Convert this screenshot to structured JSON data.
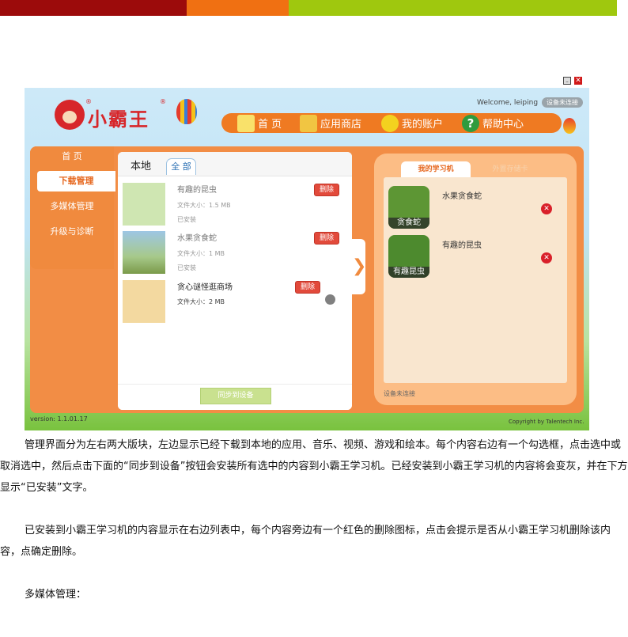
{
  "window": {
    "minimize_glyph": "–",
    "close_glyph": "✕"
  },
  "header": {
    "logo_text": "小霸王",
    "registered_mark": "®",
    "welcome": "Welcome, leiping",
    "connection_badge": "设备未连接"
  },
  "nav": [
    {
      "label": "首 页",
      "icon": "house-icon"
    },
    {
      "label": "应用商店",
      "icon": "gift-box-icon"
    },
    {
      "label": "我的账户",
      "icon": "smiley-face-icon"
    },
    {
      "label": "帮助中心",
      "icon": "question-mark-icon",
      "glyph": "?"
    }
  ],
  "sidebar": {
    "items": [
      {
        "label": "首 页"
      },
      {
        "label": "下载管理",
        "active": true
      },
      {
        "label": "多媒体管理"
      },
      {
        "label": "升级与诊断"
      }
    ]
  },
  "local_panel": {
    "title": "本地",
    "filter_tab": "全 部",
    "items": [
      {
        "name": "有趣的昆虫",
        "size": "文件大小：1.5 MB",
        "status": "已安装",
        "delete": "删除"
      },
      {
        "name": "水果贪食蛇",
        "size": "文件大小：1 MB",
        "status": "已安装",
        "delete": "删除"
      },
      {
        "name": "贪心谜怪逛商场",
        "size": "文件大小：2 MB",
        "status": "",
        "delete": "删除"
      }
    ],
    "sync_button": "同步到设备",
    "arrow_glyph": "❯"
  },
  "device_panel": {
    "tab_active": "我的学习机",
    "tab_inactive": "外置存储卡",
    "items": [
      {
        "name": "水果贪食蛇",
        "icon_caption": "贪食蛇"
      },
      {
        "name": "有趣的昆虫",
        "icon_caption": "有趣昆虫"
      }
    ],
    "delete_glyph": "✕",
    "status": "设备未连接"
  },
  "footer": {
    "version": "version: 1.1.01.17",
    "copyright": "Copyright by Talentech Inc."
  },
  "document": {
    "para1": "管理界面分为左右两大版块，左边显示已经下载到本地的应用、音乐、视频、游戏和绘本。每个内容右边有一个勾选框，点击选中或取消选中，然后点击下面的“同步到设备”按钮会安装所有选中的内容到小霸王学习机。已经安装到小霸王学习机的内容将会变灰，并在下方显示“已安装”文字。",
    "para2": "已安装到小霸王学习机的内容显示在右边列表中，每个内容旁边有一个红色的删除图标，点击会提示是否从小霸王学习机删除该内容，点确定删除。",
    "para3": "多媒体管理："
  },
  "colors": {
    "band_red": "#9c0b0b",
    "band_orange": "#f07012",
    "band_green": "#9fc80e",
    "accent_orange": "#ef7a22",
    "delete_red": "#e24a3b"
  }
}
